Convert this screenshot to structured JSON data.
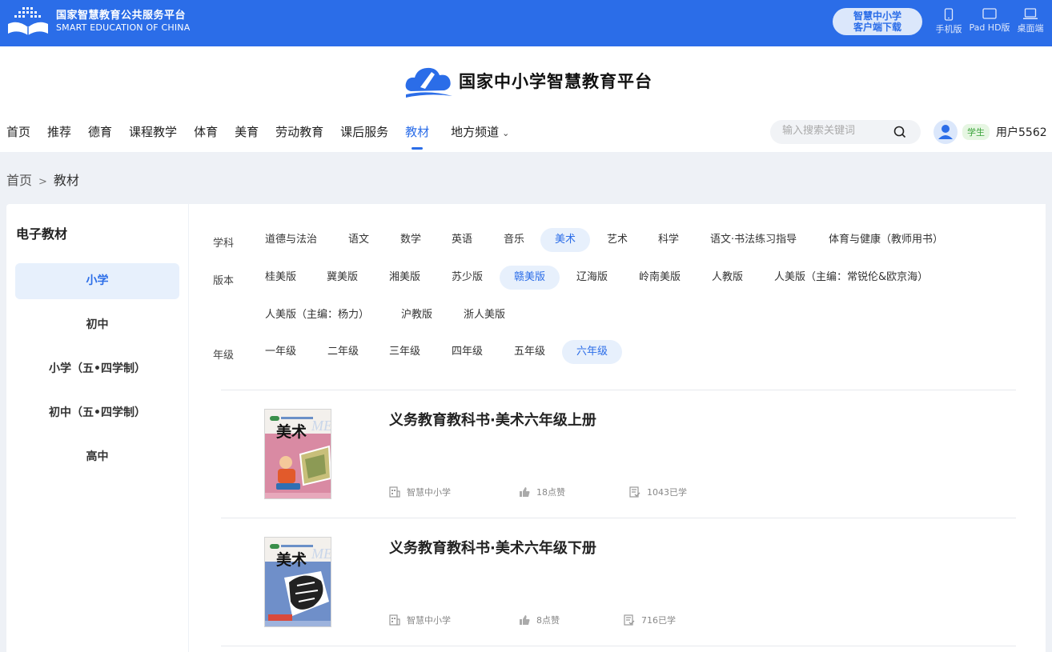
{
  "topbar": {
    "brand_cn": "国家智慧教育公共服务平台",
    "brand_en": "SMART EDUCATION OF CHINA",
    "download_line1": "智慧中小学",
    "download_line2": "客户端下载",
    "devices": [
      "手机版",
      "Pad HD版",
      "桌面端"
    ]
  },
  "header": {
    "platform_title": "国家中小学智慧教育平台",
    "nav": [
      "首页",
      "推荐",
      "德育",
      "课程教学",
      "体育",
      "美育",
      "劳动教育",
      "课后服务",
      "教材",
      "地方频道"
    ],
    "nav_active": "教材",
    "search_placeholder": "输入搜索关键词",
    "role_badge": "学生",
    "username": "用户5562"
  },
  "breadcrumb": {
    "home": "首页",
    "sep": ">",
    "current": "教材"
  },
  "sidebar": {
    "title": "电子教材",
    "items": [
      "小学",
      "初中",
      "小学（五•四学制）",
      "初中（五•四学制）",
      "高中"
    ],
    "active": "小学"
  },
  "filters": {
    "subject": {
      "label": "学科",
      "options": [
        "道德与法治",
        "语文",
        "数学",
        "英语",
        "音乐",
        "美术",
        "艺术",
        "科学",
        "语文·书法练习指导",
        "体育与健康（教师用书）"
      ],
      "selected": "美术"
    },
    "edition": {
      "label": "版本",
      "options": [
        "桂美版",
        "冀美版",
        "湘美版",
        "苏少版",
        "赣美版",
        "辽海版",
        "岭南美版",
        "人教版",
        "人美版（主编：常锐伦&欧京海）",
        "人美版（主编：杨力）",
        "沪教版",
        "浙人美版"
      ],
      "selected": "赣美版"
    },
    "grade": {
      "label": "年级",
      "options": [
        "一年级",
        "二年级",
        "三年级",
        "四年级",
        "五年级",
        "六年级"
      ],
      "selected": "六年级"
    }
  },
  "books": [
    {
      "title": "义务教育教科书·美术六年级上册",
      "source": "智慧中小学",
      "likes": "18点赞",
      "learners": "1043已学",
      "cover_color": "#d98aa3",
      "cover_text": "美术"
    },
    {
      "title": "义务教育教科书·美术六年级下册",
      "source": "智慧中小学",
      "likes": "8点赞",
      "learners": "716已学",
      "cover_color": "#6f8fc9",
      "cover_text": "美术"
    }
  ],
  "colors": {
    "primary": "#2b6de8",
    "active_bg": "#e7f0fc",
    "student_badge": "#3aa33a"
  }
}
